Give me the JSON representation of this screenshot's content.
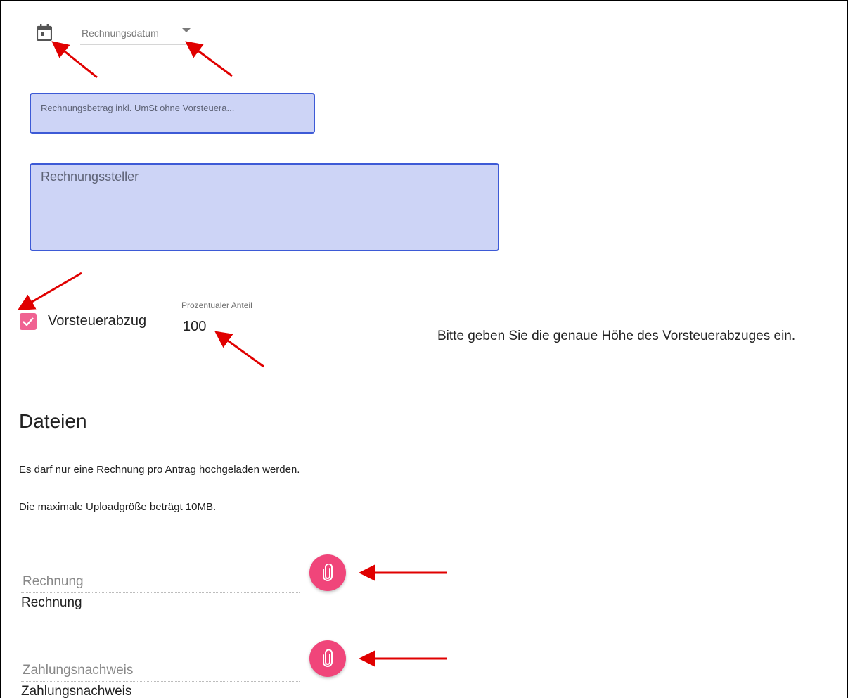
{
  "invoice_date": {
    "label": "Rechnungsdatum"
  },
  "amount": {
    "placeholder": "Rechnungsbetrag inkl. UmSt ohne Vorsteuera..."
  },
  "issuer": {
    "placeholder": "Rechnungssteller"
  },
  "vat_deduction": {
    "label": "Vorsteuerabzug",
    "checked": true
  },
  "percentage": {
    "label": "Prozentualer Anteil",
    "value": "100"
  },
  "vat_hint": "Bitte geben Sie die genaue Höhe des Vorsteuerabzuges ein.",
  "files": {
    "heading": "Dateien",
    "note1_pre": "Es darf nur ",
    "note1_link": "eine Rechnung",
    "note1_post": " pro Antrag hochgeladen werden.",
    "note2": "Die maximale Uploadgröße beträgt 10MB.",
    "uploads": [
      {
        "hint": "Rechnung",
        "value": "Rechnung"
      },
      {
        "hint": "Zahlungsnachweis",
        "value": "Zahlungsnachweis"
      }
    ]
  },
  "colors": {
    "accent_pink": "#f06292",
    "field_fill": "#cdd4f6",
    "field_border": "#3d5ad6",
    "arrow": "#e00000"
  },
  "icons": [
    "calendar-icon",
    "dropdown-caret-icon",
    "check-icon",
    "paperclip-icon"
  ]
}
